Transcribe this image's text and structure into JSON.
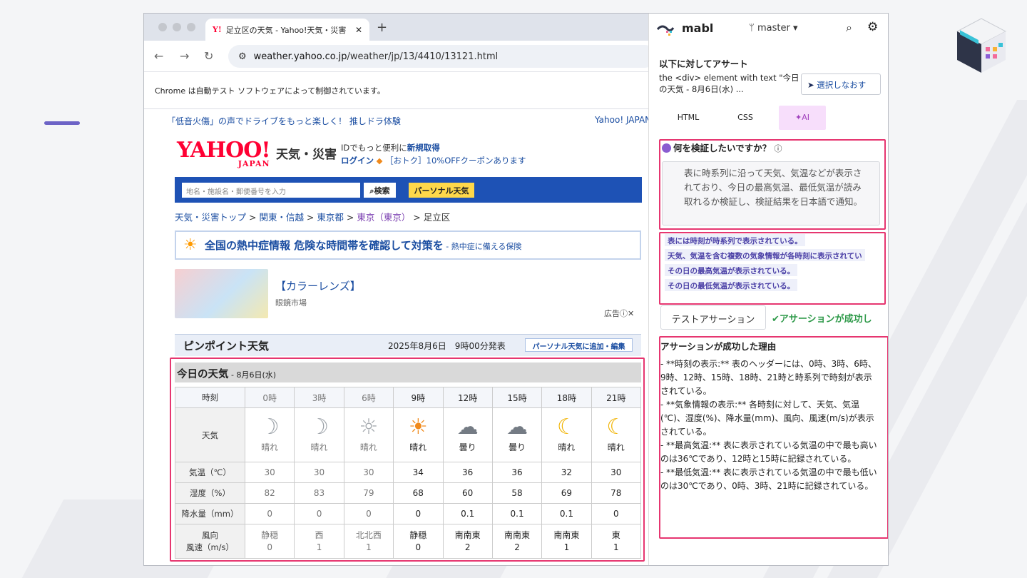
{
  "browser": {
    "tab_title": "足立区の天気 - Yahoo!天気・災害",
    "tab_favicon": "Y!",
    "url_domain": "weather.yahoo.co.jp",
    "url_path": "/weather/jp/13/4410/13121.html",
    "info_bar": "Chrome は自動テスト ソフトウェアによって制御されています。"
  },
  "page": {
    "promo_left": "「低音火傷」の声でドライブをもっと楽しく！ 推しドラ体験",
    "promo_right": "Yahoo! JAPAN",
    "logo": "YAHOO!",
    "logo_sub": "JAPAN",
    "service_title": "天気・災害",
    "login_line1_prefix": "IDでもっと便利に",
    "login_line1_link": "新規取得",
    "login_line2_link": "ログイン",
    "login_line2_text": "［おトク］10%OFFクーポンあります",
    "search_placeholder": "地名・施設名・郵便番号を入力",
    "search_button": "検索",
    "personal_button": "パーソナル天気",
    "breadcrumb": [
      "天気・災害トップ",
      "関東・信越",
      "東京都",
      "東京（東京）",
      "足立区"
    ],
    "heat_main": "全国の熱中症情報 危険な時間帯を確認して対策を",
    "heat_sub": " - 熱中症に備える保険",
    "ad_title": "【カラーレンズ】",
    "ad_sub": "眼鏡市場",
    "ad_tag": "広告ⓘ✕",
    "pinpoint_title": "ピンポイント天気",
    "pinpoint_date": "2025年8月6日　9時00分発表",
    "pinpoint_add": "パーソナル天気に追加・編集",
    "today_title": "今日の天気",
    "today_date": " - 8月6日(水)"
  },
  "weather_table": {
    "row_labels": {
      "hour": "時刻",
      "weather": "天気",
      "temp": "気温（℃）",
      "humidity": "湿度（%）",
      "precip": "降水量（mm）",
      "wind": "風向\n風速（m/s）"
    },
    "hours": [
      "0時",
      "3時",
      "6時",
      "9時",
      "12時",
      "15時",
      "18時",
      "21時"
    ],
    "weather_icons": [
      "moon-icon",
      "moon-icon",
      "cloud-sun-icon",
      "sun-cloud-icon",
      "thunder-cloud-icon",
      "thunder-cloud-icon",
      "moon-cloud-icon",
      "moon-cloud-icon"
    ],
    "weather": [
      "晴れ",
      "晴れ",
      "晴れ",
      "晴れ",
      "曇り",
      "曇り",
      "晴れ",
      "晴れ"
    ],
    "temp": [
      "30",
      "30",
      "30",
      "34",
      "36",
      "36",
      "32",
      "30"
    ],
    "humidity": [
      "82",
      "83",
      "79",
      "68",
      "60",
      "58",
      "69",
      "78"
    ],
    "precip": [
      "0",
      "0",
      "0",
      "0",
      "0.1",
      "0.1",
      "0.1",
      "0"
    ],
    "wind_dir": [
      "静穏",
      "西",
      "北北西",
      "静穏",
      "南南東",
      "南南東",
      "南南東",
      "東"
    ],
    "wind_speed": [
      "0",
      "1",
      "1",
      "0",
      "2",
      "2",
      "1",
      "1"
    ],
    "past_count": 3
  },
  "mabl": {
    "brand": "mabl",
    "branch": "master",
    "assert_label": "以下に対してアサート",
    "element_desc": "the <div> element with text \"今日の天気 - 8月6日(水) ...",
    "reselect": "選択しなおす",
    "tabs": [
      "HTML",
      "CSS",
      "AI"
    ],
    "question_title": "何を検証したいですか？",
    "question_text": "表に時系列に沿って天気、気温などが表示されており、今日の最高気温、最低気温が読み取れるか検証し、検証結果を日本語で通知。",
    "assertions": [
      "表には時刻が時系列で表示されている。",
      "天気、気温を含む複数の気象情報が各時刻に表示されてい",
      "その日の最高気温が表示されている。",
      "その日の最低気温が表示されている。"
    ],
    "test_button": "テストアサーション",
    "success": "アサーションが成功し",
    "reason_title": "アサーションが成功した理由",
    "reason_lines": [
      "- **時刻の表示:** 表のヘッダーには、0時、3時、6時、9時、12時、15時、18時、21時と時系列で時刻が表示されている。",
      "- **気象情報の表示:** 各時刻に対して、天気、気温(℃)、湿度(%)、降水量(mm)、風向、風速(m/s)が表示されている。",
      "- **最高気温:** 表に表示されている気温の中で最も高いのは36℃であり、12時と15時に記録されている。",
      "- **最低気温:** 表に表示されている気温の中で最も低いのは30℃であり、0時、3時、21時に記録されている。"
    ]
  },
  "colors": {
    "highlight": "#e63670",
    "yahoo_red": "#ff0033",
    "yahoo_blue": "#1e52b5",
    "success": "#2f9a4a",
    "ai_purple": "#a040bd"
  }
}
